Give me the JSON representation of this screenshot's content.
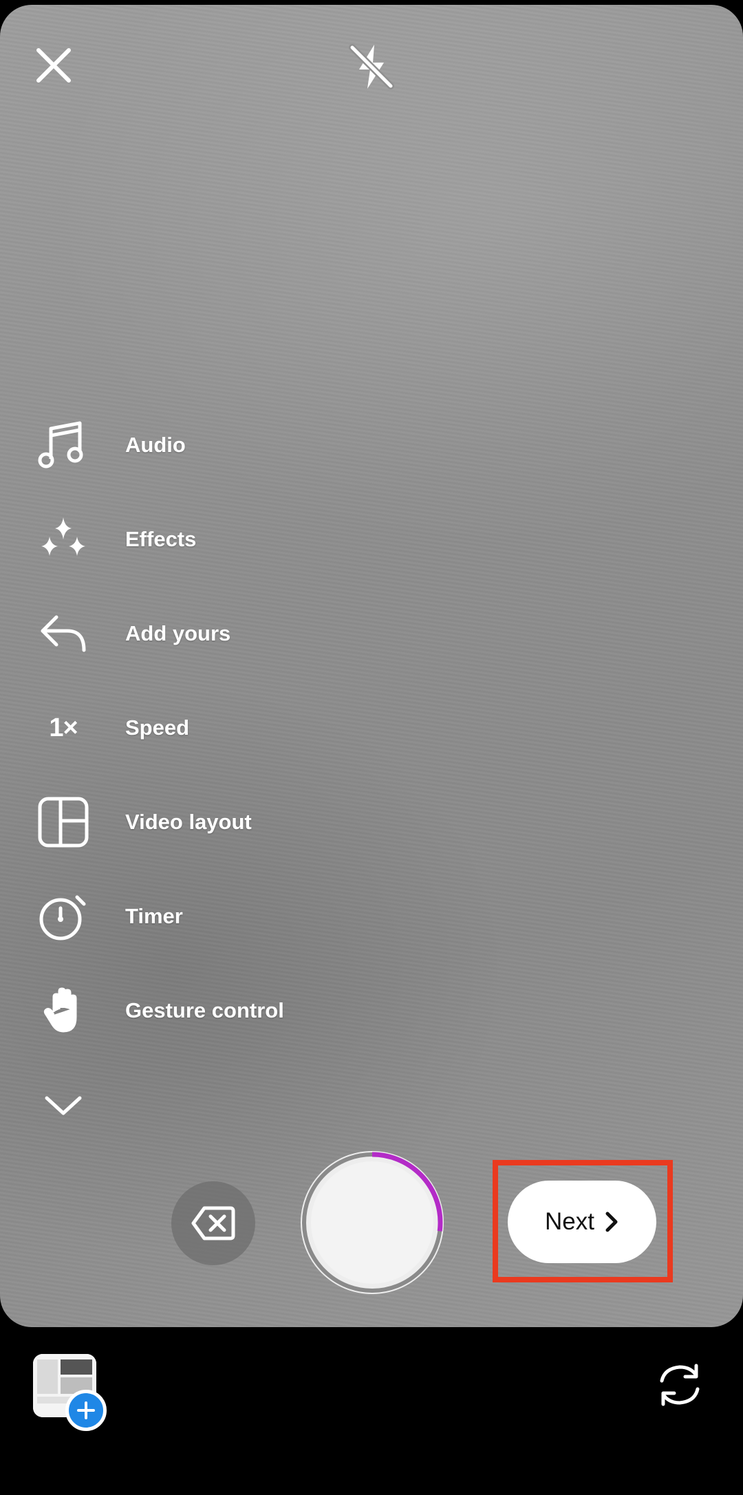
{
  "top_bar": {
    "close_icon": "close-icon",
    "flash_icon": "flash-off-icon"
  },
  "tools": [
    {
      "label": "Audio",
      "icon": "music-note-icon"
    },
    {
      "label": "Effects",
      "icon": "sparkles-icon"
    },
    {
      "label": "Add yours",
      "icon": "reply-arrow-icon"
    },
    {
      "label": "Speed",
      "icon": "speed-icon",
      "glyph": "1×"
    },
    {
      "label": "Video layout",
      "icon": "layout-grid-icon"
    },
    {
      "label": "Timer",
      "icon": "timer-icon"
    },
    {
      "label": "Gesture control",
      "icon": "hand-icon"
    }
  ],
  "more_tools_icon": "chevron-down-icon",
  "controls": {
    "next_label": "Next",
    "record_progress": 0.27,
    "progress_color": "#b32bc7",
    "highlight_color": "#ea3a1f"
  },
  "bottom_bar": {
    "gallery_icon": "gallery-thumbnail",
    "flip_icon": "flip-camera-icon"
  }
}
